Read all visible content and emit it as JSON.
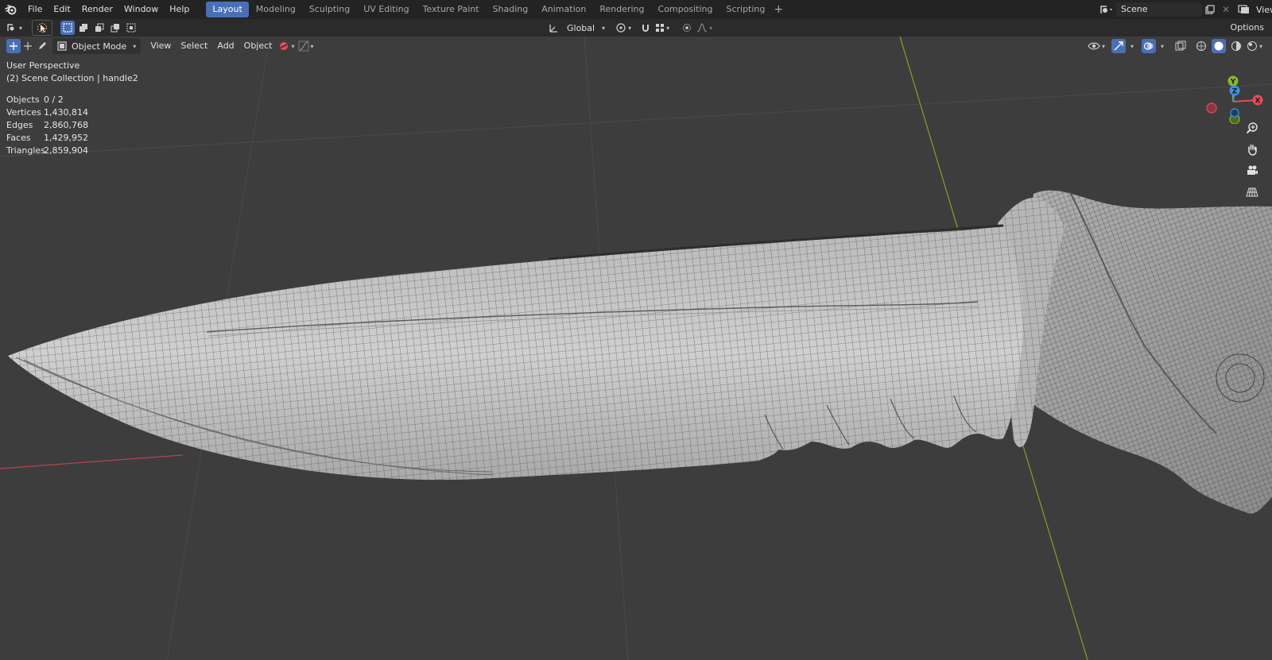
{
  "menu": [
    "File",
    "Edit",
    "Render",
    "Window",
    "Help"
  ],
  "workspaces": [
    {
      "label": "Layout",
      "active": true
    },
    {
      "label": "Modeling",
      "active": false
    },
    {
      "label": "Sculpting",
      "active": false
    },
    {
      "label": "UV Editing",
      "active": false
    },
    {
      "label": "Texture Paint",
      "active": false
    },
    {
      "label": "Shading",
      "active": false
    },
    {
      "label": "Animation",
      "active": false
    },
    {
      "label": "Rendering",
      "active": false
    },
    {
      "label": "Compositing",
      "active": false
    },
    {
      "label": "Scripting",
      "active": false
    }
  ],
  "workspace_add": "+",
  "scene": {
    "name": "Scene",
    "view_layer_label": "View"
  },
  "toolbar": {
    "orientation": "Global",
    "options": "Options"
  },
  "viewport_header": {
    "mode": "Object Mode",
    "menus": [
      "View",
      "Select",
      "Add",
      "Object"
    ]
  },
  "overlay": {
    "view_name": "User Perspective",
    "collection_info": "(2) Scene Collection | handle2"
  },
  "stats": [
    {
      "label": "Objects",
      "value": "0 / 2"
    },
    {
      "label": "Vertices",
      "value": "1,430,814"
    },
    {
      "label": "Edges",
      "value": "2,860,768"
    },
    {
      "label": "Faces",
      "value": "1,429,952"
    },
    {
      "label": "Triangles",
      "value": "2,859,904"
    }
  ],
  "gizmo": {
    "x": "X",
    "y": "Y",
    "z": "Z"
  },
  "colors": {
    "accent": "#4a6fb5",
    "x_axis": "#e84a5a",
    "y_axis": "#8ab62e",
    "z_axis": "#3e8ee8",
    "viewport_bg": "#3d3d3d",
    "mesh_fill": "#c8c8c8",
    "wire": "#3a3a3a"
  },
  "icons": [
    "blender-logo-icon",
    "editor-type-icon",
    "select-tool-icon",
    "box-select-mode-icons",
    "transform-pivot-icon",
    "snap-icon",
    "proportional-edit-icon",
    "visibility-icon",
    "gizmo-toggle-icon",
    "overlay-icon",
    "xray-icon",
    "shading-wire-icon",
    "shading-solid-icon",
    "shading-material-icon",
    "shading-rendered-icon",
    "zoom-icon",
    "pan-hand-icon",
    "camera-icon",
    "grid-perspective-icon"
  ]
}
